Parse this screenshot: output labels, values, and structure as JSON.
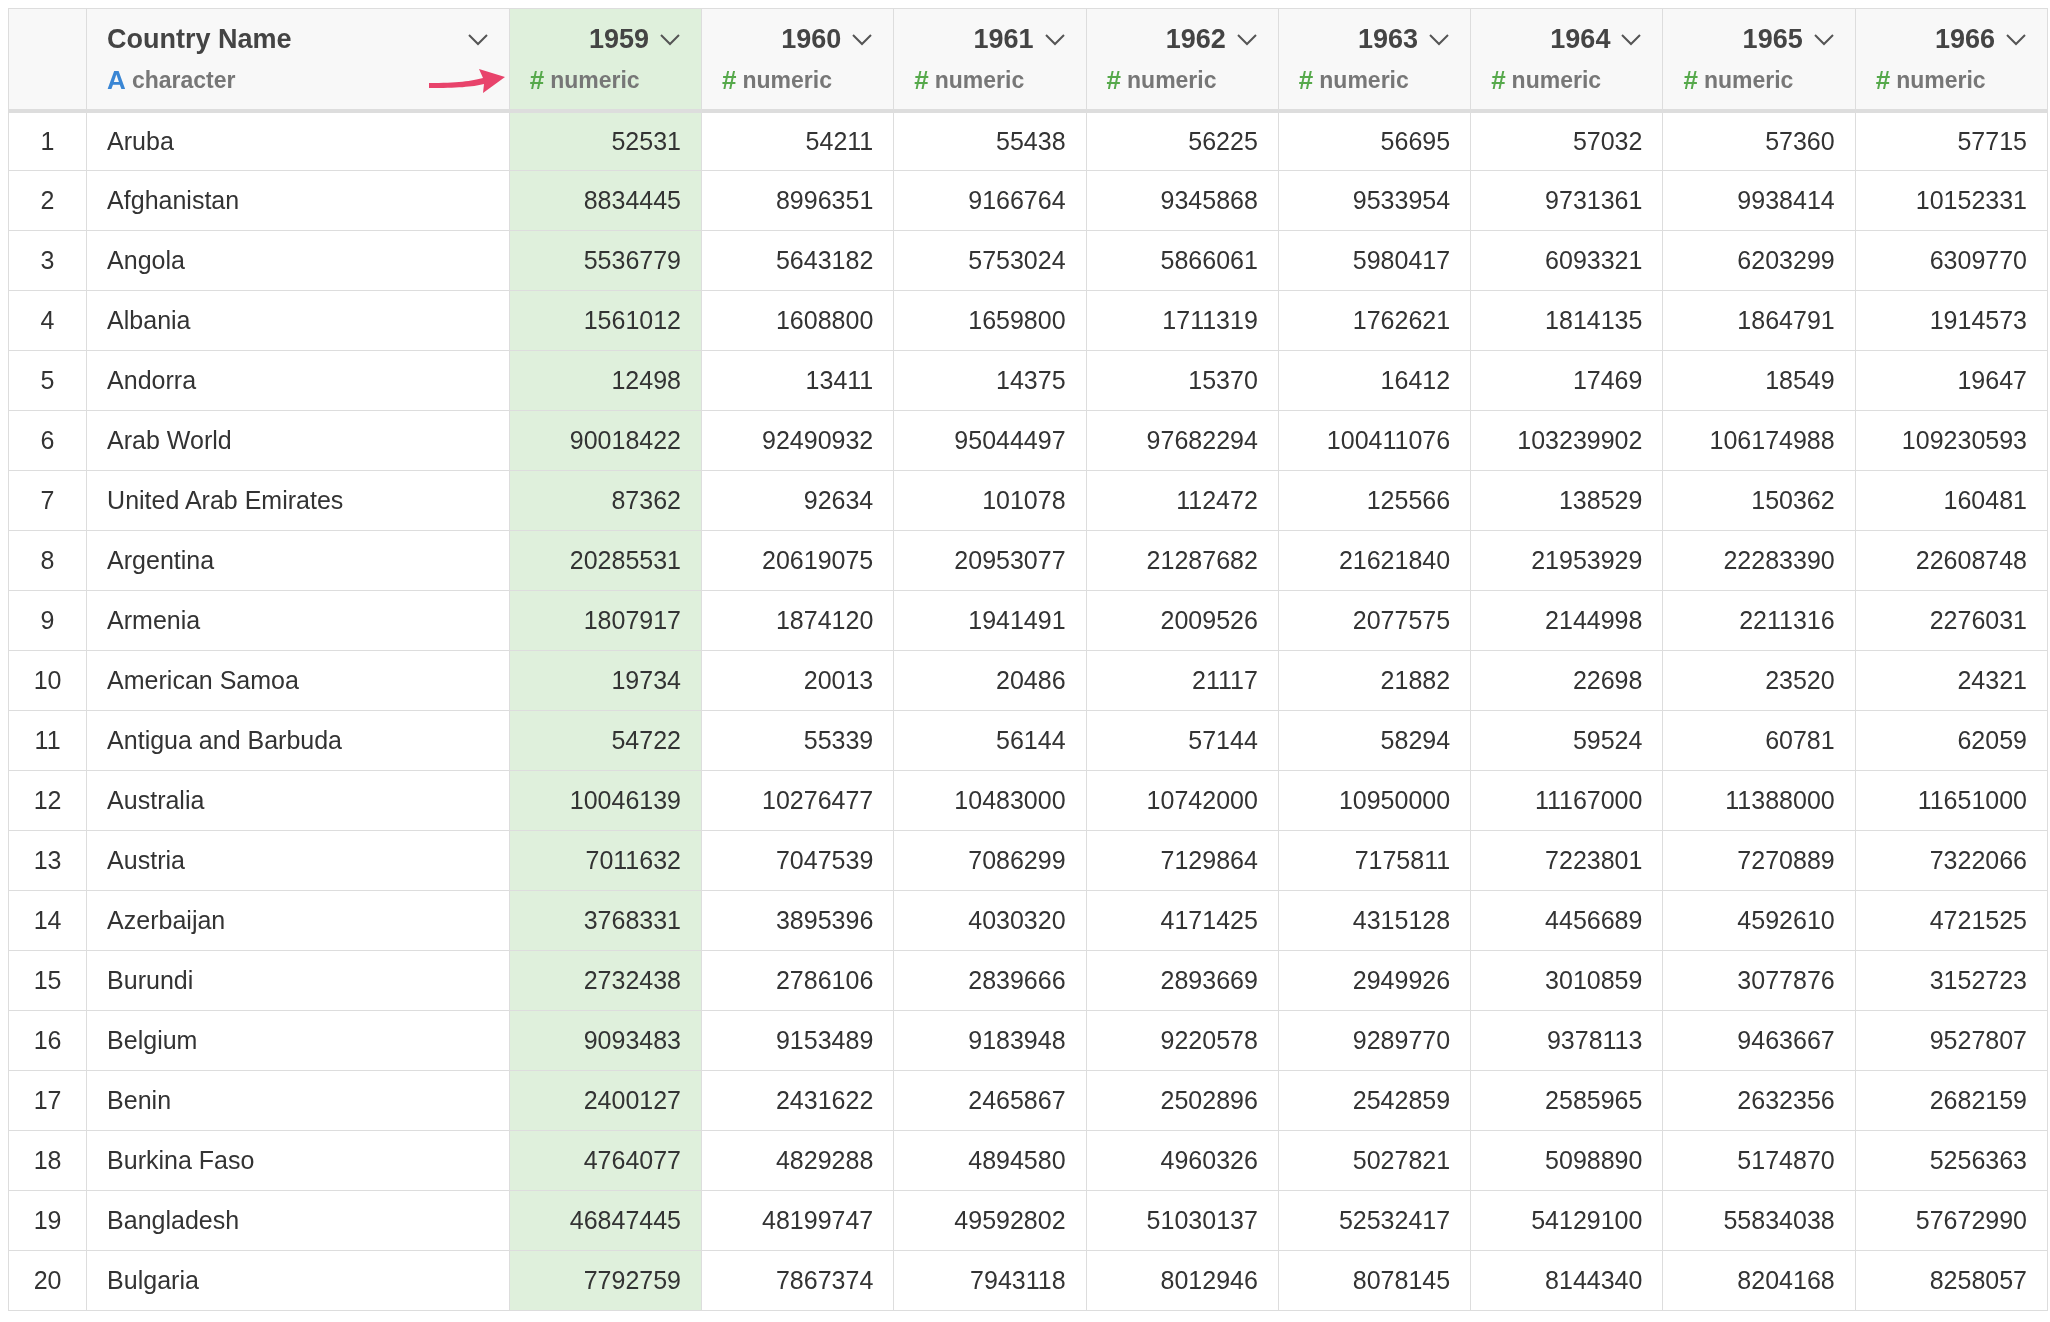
{
  "table": {
    "columns": [
      {
        "name": "Country Name",
        "kind": "character",
        "type_symbol": "A",
        "type_label": "character",
        "selected": false
      },
      {
        "name": "1959",
        "kind": "numeric",
        "type_symbol": "#",
        "type_label": "numeric",
        "selected": true
      },
      {
        "name": "1960",
        "kind": "numeric",
        "type_symbol": "#",
        "type_label": "numeric",
        "selected": false
      },
      {
        "name": "1961",
        "kind": "numeric",
        "type_symbol": "#",
        "type_label": "numeric",
        "selected": false
      },
      {
        "name": "1962",
        "kind": "numeric",
        "type_symbol": "#",
        "type_label": "numeric",
        "selected": false
      },
      {
        "name": "1963",
        "kind": "numeric",
        "type_symbol": "#",
        "type_label": "numeric",
        "selected": false
      },
      {
        "name": "1964",
        "kind": "numeric",
        "type_symbol": "#",
        "type_label": "numeric",
        "selected": false
      },
      {
        "name": "1965",
        "kind": "numeric",
        "type_symbol": "#",
        "type_label": "numeric",
        "selected": false
      },
      {
        "name": "1966",
        "kind": "numeric",
        "type_symbol": "#",
        "type_label": "numeric",
        "selected": false
      }
    ],
    "rows": [
      {
        "index": "1",
        "cells": [
          "Aruba",
          "52531",
          "54211",
          "55438",
          "56225",
          "56695",
          "57032",
          "57360",
          "57715"
        ]
      },
      {
        "index": "2",
        "cells": [
          "Afghanistan",
          "8834445",
          "8996351",
          "9166764",
          "9345868",
          "9533954",
          "9731361",
          "9938414",
          "10152331"
        ]
      },
      {
        "index": "3",
        "cells": [
          "Angola",
          "5536779",
          "5643182",
          "5753024",
          "5866061",
          "5980417",
          "6093321",
          "6203299",
          "6309770"
        ]
      },
      {
        "index": "4",
        "cells": [
          "Albania",
          "1561012",
          "1608800",
          "1659800",
          "1711319",
          "1762621",
          "1814135",
          "1864791",
          "1914573"
        ]
      },
      {
        "index": "5",
        "cells": [
          "Andorra",
          "12498",
          "13411",
          "14375",
          "15370",
          "16412",
          "17469",
          "18549",
          "19647"
        ]
      },
      {
        "index": "6",
        "cells": [
          "Arab World",
          "90018422",
          "92490932",
          "95044497",
          "97682294",
          "100411076",
          "103239902",
          "106174988",
          "109230593"
        ]
      },
      {
        "index": "7",
        "cells": [
          "United Arab Emirates",
          "87362",
          "92634",
          "101078",
          "112472",
          "125566",
          "138529",
          "150362",
          "160481"
        ]
      },
      {
        "index": "8",
        "cells": [
          "Argentina",
          "20285531",
          "20619075",
          "20953077",
          "21287682",
          "21621840",
          "21953929",
          "22283390",
          "22608748"
        ]
      },
      {
        "index": "9",
        "cells": [
          "Armenia",
          "1807917",
          "1874120",
          "1941491",
          "2009526",
          "2077575",
          "2144998",
          "2211316",
          "2276031"
        ]
      },
      {
        "index": "10",
        "cells": [
          "American Samoa",
          "19734",
          "20013",
          "20486",
          "21117",
          "21882",
          "22698",
          "23520",
          "24321"
        ]
      },
      {
        "index": "11",
        "cells": [
          "Antigua and Barbuda",
          "54722",
          "55339",
          "56144",
          "57144",
          "58294",
          "59524",
          "60781",
          "62059"
        ]
      },
      {
        "index": "12",
        "cells": [
          "Australia",
          "10046139",
          "10276477",
          "10483000",
          "10742000",
          "10950000",
          "11167000",
          "11388000",
          "11651000"
        ]
      },
      {
        "index": "13",
        "cells": [
          "Austria",
          "7011632",
          "7047539",
          "7086299",
          "7129864",
          "7175811",
          "7223801",
          "7270889",
          "7322066"
        ]
      },
      {
        "index": "14",
        "cells": [
          "Azerbaijan",
          "3768331",
          "3895396",
          "4030320",
          "4171425",
          "4315128",
          "4456689",
          "4592610",
          "4721525"
        ]
      },
      {
        "index": "15",
        "cells": [
          "Burundi",
          "2732438",
          "2786106",
          "2839666",
          "2893669",
          "2949926",
          "3010859",
          "3077876",
          "3152723"
        ]
      },
      {
        "index": "16",
        "cells": [
          "Belgium",
          "9093483",
          "9153489",
          "9183948",
          "9220578",
          "9289770",
          "9378113",
          "9463667",
          "9527807"
        ]
      },
      {
        "index": "17",
        "cells": [
          "Benin",
          "2400127",
          "2431622",
          "2465867",
          "2502896",
          "2542859",
          "2585965",
          "2632356",
          "2682159"
        ]
      },
      {
        "index": "18",
        "cells": [
          "Burkina Faso",
          "4764077",
          "4829288",
          "4894580",
          "4960326",
          "5027821",
          "5098890",
          "5174870",
          "5256363"
        ]
      },
      {
        "index": "19",
        "cells": [
          "Bangladesh",
          "46847445",
          "48199747",
          "49592802",
          "51030137",
          "52532417",
          "54129100",
          "55834038",
          "57672990"
        ]
      },
      {
        "index": "20",
        "cells": [
          "Bulgaria",
          "7792759",
          "7867374",
          "7943118",
          "8012946",
          "8078145",
          "8144340",
          "8204168",
          "8258057"
        ]
      }
    ]
  }
}
